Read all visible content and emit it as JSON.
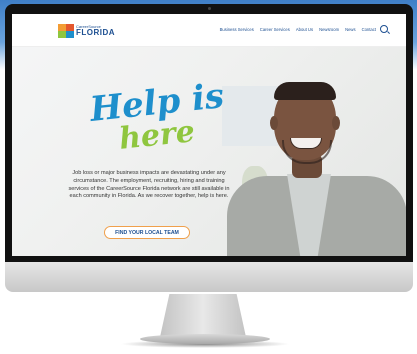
{
  "site": {
    "logo_small": "CareerSource",
    "logo_big": "FLORIDA"
  },
  "nav": {
    "items": [
      "Business Services",
      "Career Services",
      "About Us",
      "Newsroom",
      "News",
      "Contact"
    ],
    "search_icon": "search-icon"
  },
  "hero": {
    "headline_1": "Help is",
    "headline_2": "here",
    "body": "Job loss or major business impacts are devastating under any circumstance. The employment, recruiting, hiring and training services of the CareerSource Florida network are still available in each community in Florida. As we recover together, help is here.",
    "cta_label": "FIND YOUR LOCAL TEAM"
  },
  "colors": {
    "brand_blue": "#1d4f91",
    "headline_blue": "#1e8fcc",
    "headline_green": "#8fc63f",
    "cta_border": "#f0a04b"
  }
}
